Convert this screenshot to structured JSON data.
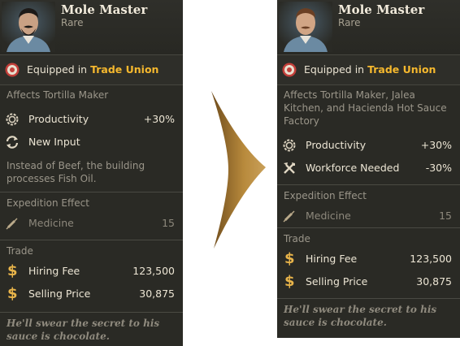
{
  "before": {
    "name": "Mole Master",
    "rarity": "Rare",
    "equipped_prefix": "Equipped in ",
    "equipped_building": "Trade Union",
    "affects": "Affects Tortilla Maker",
    "effects": [
      {
        "icon": "productivity-gear-icon",
        "label": "Productivity",
        "value": "+30%"
      },
      {
        "icon": "new-input-cycle-icon",
        "label": "New Input",
        "value": ""
      }
    ],
    "input_note": "Instead of Beef, the building processes Fish Oil.",
    "expedition_title": "Expedition Effect",
    "expedition_item": {
      "icon": "medicine-syringe-icon",
      "label": "Medicine",
      "value": "15"
    },
    "trade_title": "Trade",
    "trade": [
      {
        "icon": "dollar-icon",
        "label": "Hiring Fee",
        "value": "123,500"
      },
      {
        "icon": "dollar-icon",
        "label": "Selling Price",
        "value": "30,875"
      }
    ],
    "quote": "He'll swear the secret to his sauce is chocolate."
  },
  "after": {
    "name": "Mole Master",
    "rarity": "Rare",
    "equipped_prefix": "Equipped in ",
    "equipped_building": "Trade Union",
    "affects": "Affects Tortilla Maker, Jalea Kitchen, and Hacienda Hot Sauce Factory",
    "effects": [
      {
        "icon": "productivity-gear-icon",
        "label": "Productivity",
        "value": "+30%"
      },
      {
        "icon": "workforce-tools-icon",
        "label": "Workforce Needed",
        "value": "-30%"
      }
    ],
    "expedition_title": "Expedition Effect",
    "expedition_item": {
      "icon": "medicine-syringe-icon",
      "label": "Medicine",
      "value": "15"
    },
    "trade_title": "Trade",
    "trade": [
      {
        "icon": "dollar-icon",
        "label": "Hiring Fee",
        "value": "123,500"
      },
      {
        "icon": "dollar-icon",
        "label": "Selling Price",
        "value": "30,875"
      }
    ],
    "quote": "He'll swear the secret to his sauce is chocolate."
  },
  "colors": {
    "panel_bg": "#2a2a25",
    "highlight": "#f5b82e",
    "arrow": "#b88a3c"
  }
}
